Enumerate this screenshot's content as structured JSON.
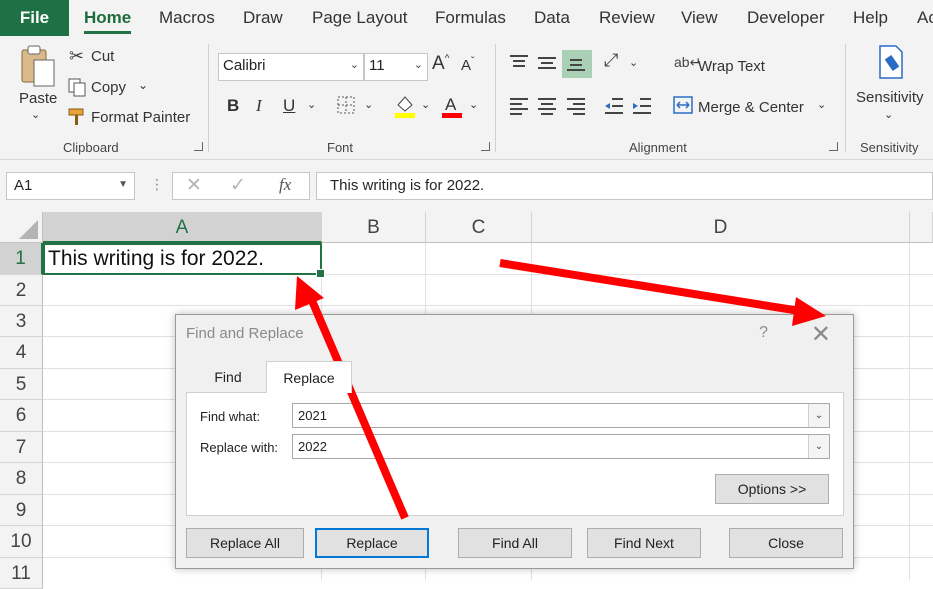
{
  "ribbon_tabs": [
    "Home",
    "Macros",
    "Draw",
    "Page Layout",
    "Formulas",
    "Data",
    "Review",
    "View",
    "Developer",
    "Help",
    "Ac"
  ],
  "file_tab": "File",
  "clipboard": {
    "paste": "Paste",
    "cut": "Cut",
    "copy": "Copy",
    "format_painter": "Format Painter",
    "group_label": "Clipboard"
  },
  "font": {
    "family": "Calibri",
    "size": "11",
    "bold": "B",
    "italic": "I",
    "underline": "U",
    "group_label": "Font",
    "highlight_color": "#ffff00",
    "font_color": "#ff0000"
  },
  "alignment": {
    "wrap_text": "Wrap Text",
    "merge_center": "Merge & Center",
    "group_label": "Alignment"
  },
  "sensitivity": {
    "button": "Sensitivity",
    "group_label": "Sensitivity"
  },
  "formula_bar": {
    "name_box": "A1",
    "content": "This writing is for 2022."
  },
  "grid": {
    "columns": [
      "A",
      "B",
      "C",
      "D"
    ],
    "rows": [
      "1",
      "2",
      "3",
      "4",
      "5",
      "6",
      "7",
      "8",
      "9",
      "10",
      "11"
    ],
    "cell_a1": "This writing is for 2022."
  },
  "dialog": {
    "title": "Find and Replace",
    "help": "?",
    "tabs": [
      "Find",
      "Replace"
    ],
    "find_label": "Find what:",
    "find_value": "2021",
    "replace_label": "Replace with:",
    "replace_value": "2022",
    "options": "Options >>",
    "buttons": [
      "Replace All",
      "Replace",
      "Find All",
      "Find Next",
      "Close"
    ]
  },
  "colors": {
    "excel_green": "#217346",
    "arrow_red": "#ff0000"
  }
}
